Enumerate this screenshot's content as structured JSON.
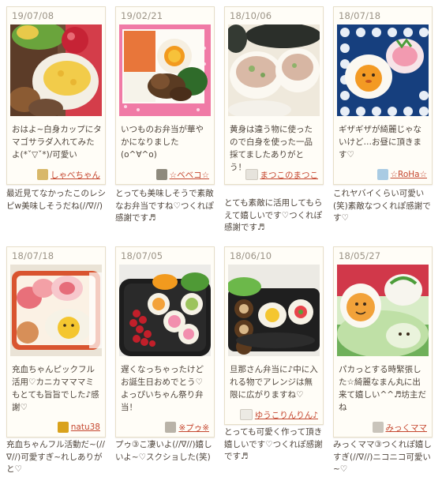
{
  "recipes": [
    {
      "date": "19/07/08",
      "title": "おはよ~白身カップにタマゴサラダ入れてみたよ(*ˇ▽ˇ*)/可愛い",
      "author": "しゃべちゃん",
      "avatar_color": "#d8b86a",
      "comment": "最近見てなかったこのレシピw美味しそうだね(//∇//)"
    },
    {
      "date": "19/02/21",
      "title": "いつものお弁当が華やかになりました(o^∀^o)",
      "author": "☆ベベコ☆",
      "avatar_color": "#8e8a7d",
      "comment": "とっても美味しそうで素敵なお弁当ですね♡つくれぽ感謝です♬"
    },
    {
      "date": "18/10/06",
      "title": "黄身は違う物に使ったので白身を使った一品採てましたありがとう！",
      "author": "まつこのまつこ",
      "avatar_color": "#e6e3dc",
      "comment": "とても素敵に活用してもらえて嬉しいです♡つくれぽ感謝です♬"
    },
    {
      "date": "18/07/18",
      "title": "ギザギザが綺麗じゃないけど…お昼に頂きます♡",
      "author": "☆RoHa☆",
      "avatar_color": "#a9cbe3",
      "comment": "これヤバイくらい可愛い(笑)素敵なつくれぽ感謝です♡"
    },
    {
      "date": "18/07/18",
      "title": "充血ちゃんピックフル活用♡カニカマママミもとても旨旨でした♪感謝♡",
      "author": "natu38",
      "avatar_color": "#d9a21c",
      "comment": "充血ちゃんフル活動だ~(//∇//)可愛すぎ~れしありがと♡"
    },
    {
      "date": "18/07/05",
      "title": "遅くなっちゃったけどお誕生日おめでとう♡よっぴいちゃん祭り弁当！",
      "author": "※プゥ※",
      "avatar_color": "#b9b3a8",
      "comment": "プゥ③こ凄いよ(//∇//)嬉しいよ~♡スクショした(笑)"
    },
    {
      "date": "18/06/10",
      "title": "旦那さん弁当に♪中に入れる物でアレンジは無限に広がりますね♡",
      "author": "ゆうこりんりん♪",
      "avatar_color": "#eceae4",
      "comment": "とっても可愛く作って頂き嬉しいです♡つくれぽ感謝です♬"
    },
    {
      "date": "18/05/27",
      "title": "パカっとする時緊張した☆綺麗なまん丸に出来て嬉しい^^♬坊主だね",
      "author": "みっくママ",
      "avatar_color": "#c9c4bb",
      "comment": "みっくママ③つくれぽ嬉しすぎ(//∇//)ニコニコ可愛い~♡"
    }
  ]
}
